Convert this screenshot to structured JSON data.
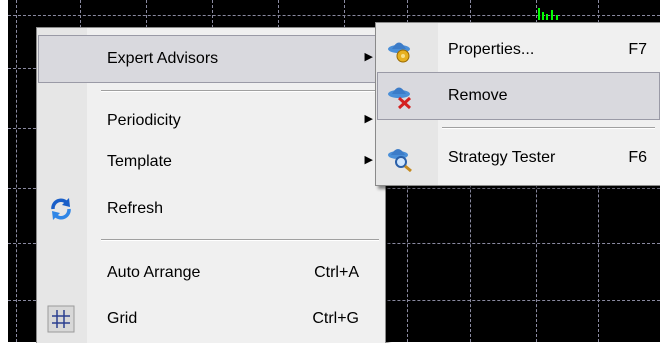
{
  "context_menu": {
    "items": [
      {
        "label": "Expert Advisors",
        "accel": ""
      },
      {
        "label": "Periodicity",
        "accel": ""
      },
      {
        "label": "Template",
        "accel": ""
      },
      {
        "label": "Refresh",
        "accel": "",
        "icon": "refresh-icon"
      },
      {
        "label": "Auto Arrange",
        "accel": "Ctrl+A"
      },
      {
        "label": "Grid",
        "accel": "Ctrl+G",
        "icon": "grid-icon"
      }
    ]
  },
  "submenu": {
    "items": [
      {
        "label": "Properties...",
        "accel": "F7",
        "icon": "expert-properties-icon"
      },
      {
        "label": "Remove",
        "accel": "",
        "icon": "expert-remove-icon"
      },
      {
        "label": "Strategy Tester",
        "accel": "F6",
        "icon": "strategy-tester-icon"
      }
    ]
  },
  "colors": {
    "chart_background": "#000000",
    "grid_line": "#8a8aa0",
    "menu_background": "#f0f0f0",
    "candle": "#00ff00"
  }
}
